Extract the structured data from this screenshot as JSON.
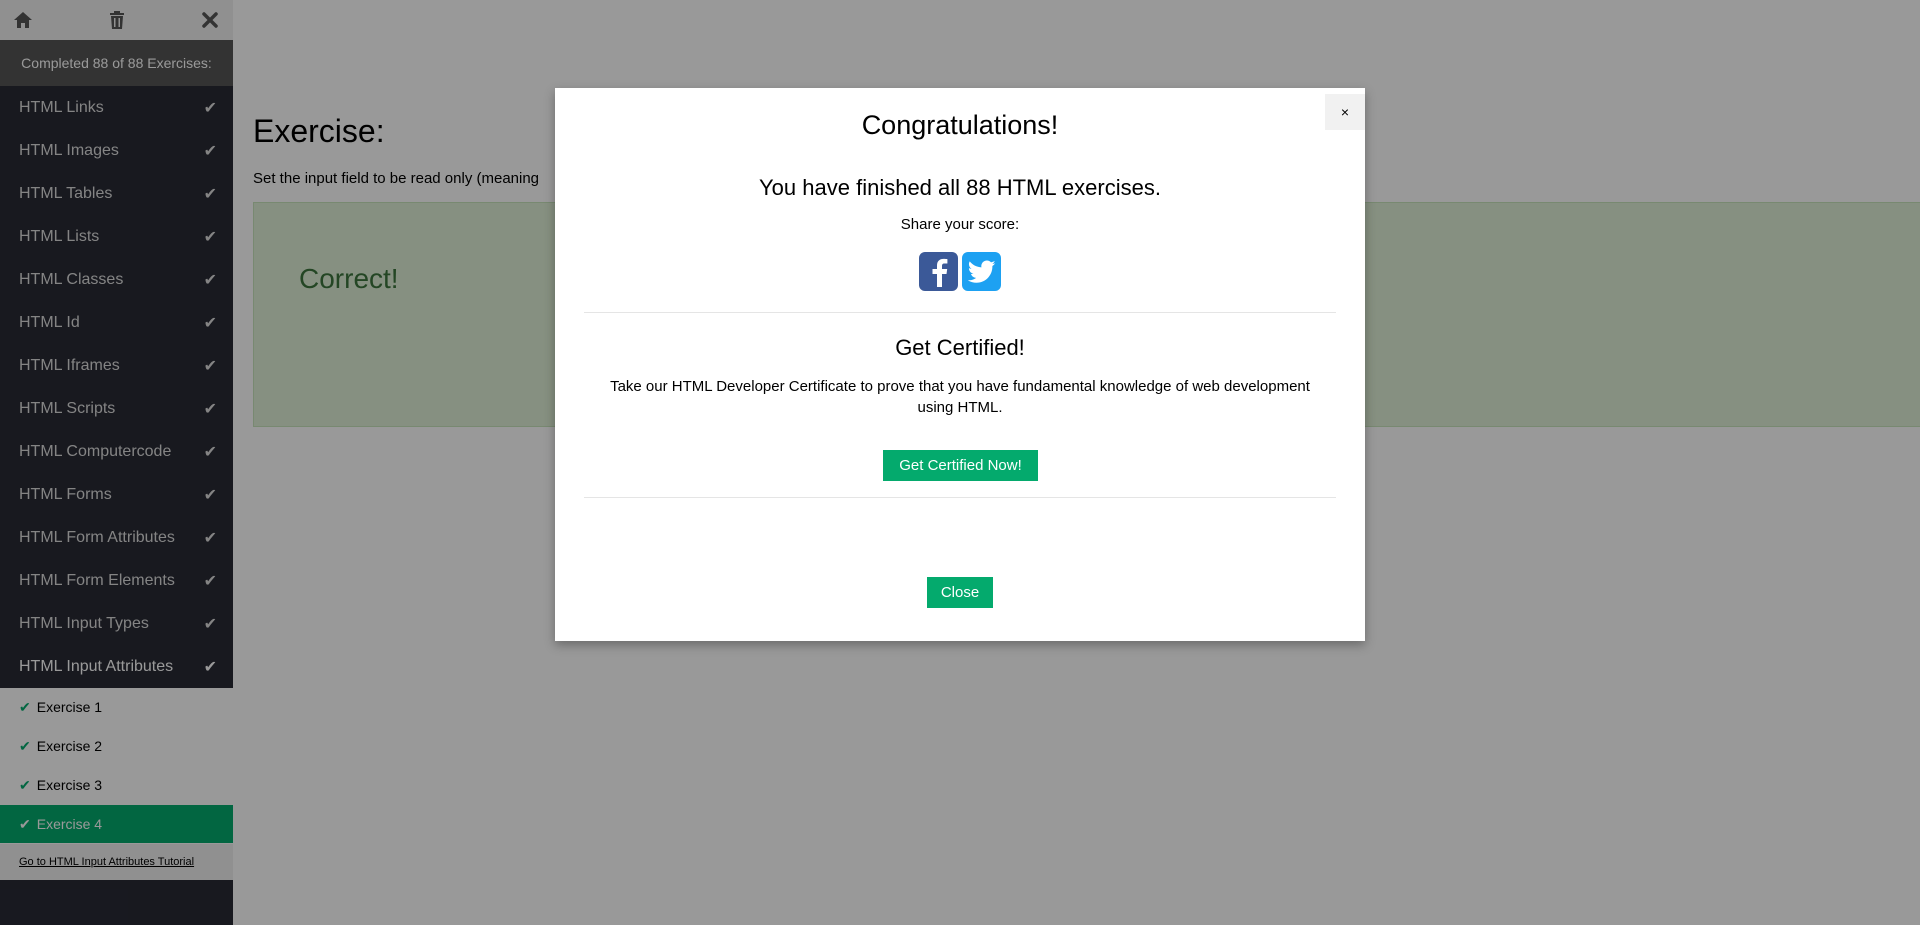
{
  "sidebar": {
    "progress_text": "Completed 88 of 88 Exercises:",
    "chapters": [
      {
        "label": "HTML Links"
      },
      {
        "label": "HTML Images"
      },
      {
        "label": "HTML Tables"
      },
      {
        "label": "HTML Lists"
      },
      {
        "label": "HTML Classes"
      },
      {
        "label": "HTML Id"
      },
      {
        "label": "HTML Iframes"
      },
      {
        "label": "HTML Scripts"
      },
      {
        "label": "HTML Computercode"
      },
      {
        "label": "HTML Forms"
      },
      {
        "label": "HTML Form Attributes"
      },
      {
        "label": "HTML Form Elements"
      },
      {
        "label": "HTML Input Types"
      },
      {
        "label": "HTML Input Attributes"
      }
    ],
    "exercises": [
      {
        "label": "Exercise 1"
      },
      {
        "label": "Exercise 2"
      },
      {
        "label": "Exercise 3"
      },
      {
        "label": "Exercise 4"
      }
    ],
    "tutorial_link": "Go to HTML Input Attributes Tutorial"
  },
  "main": {
    "title": "Exercise:",
    "description": "Set the input field to be read only (meaning",
    "result": "Correct!"
  },
  "modal": {
    "title": "Congratulations!",
    "finished": "You have finished all 88 HTML exercises.",
    "share": "Share your score:",
    "cert_title": "Get Certified!",
    "cert_text": "Take our HTML Developer Certificate to prove that you have fundamental knowledge of web development using HTML.",
    "cert_button": "Get Certified Now!",
    "close_button": "Close",
    "close_x": "×"
  },
  "colors": {
    "accent_green": "#04AA6D",
    "sidebar_bg": "#282A35",
    "facebook": "#3B5998",
    "twitter": "#1DA1F2"
  }
}
